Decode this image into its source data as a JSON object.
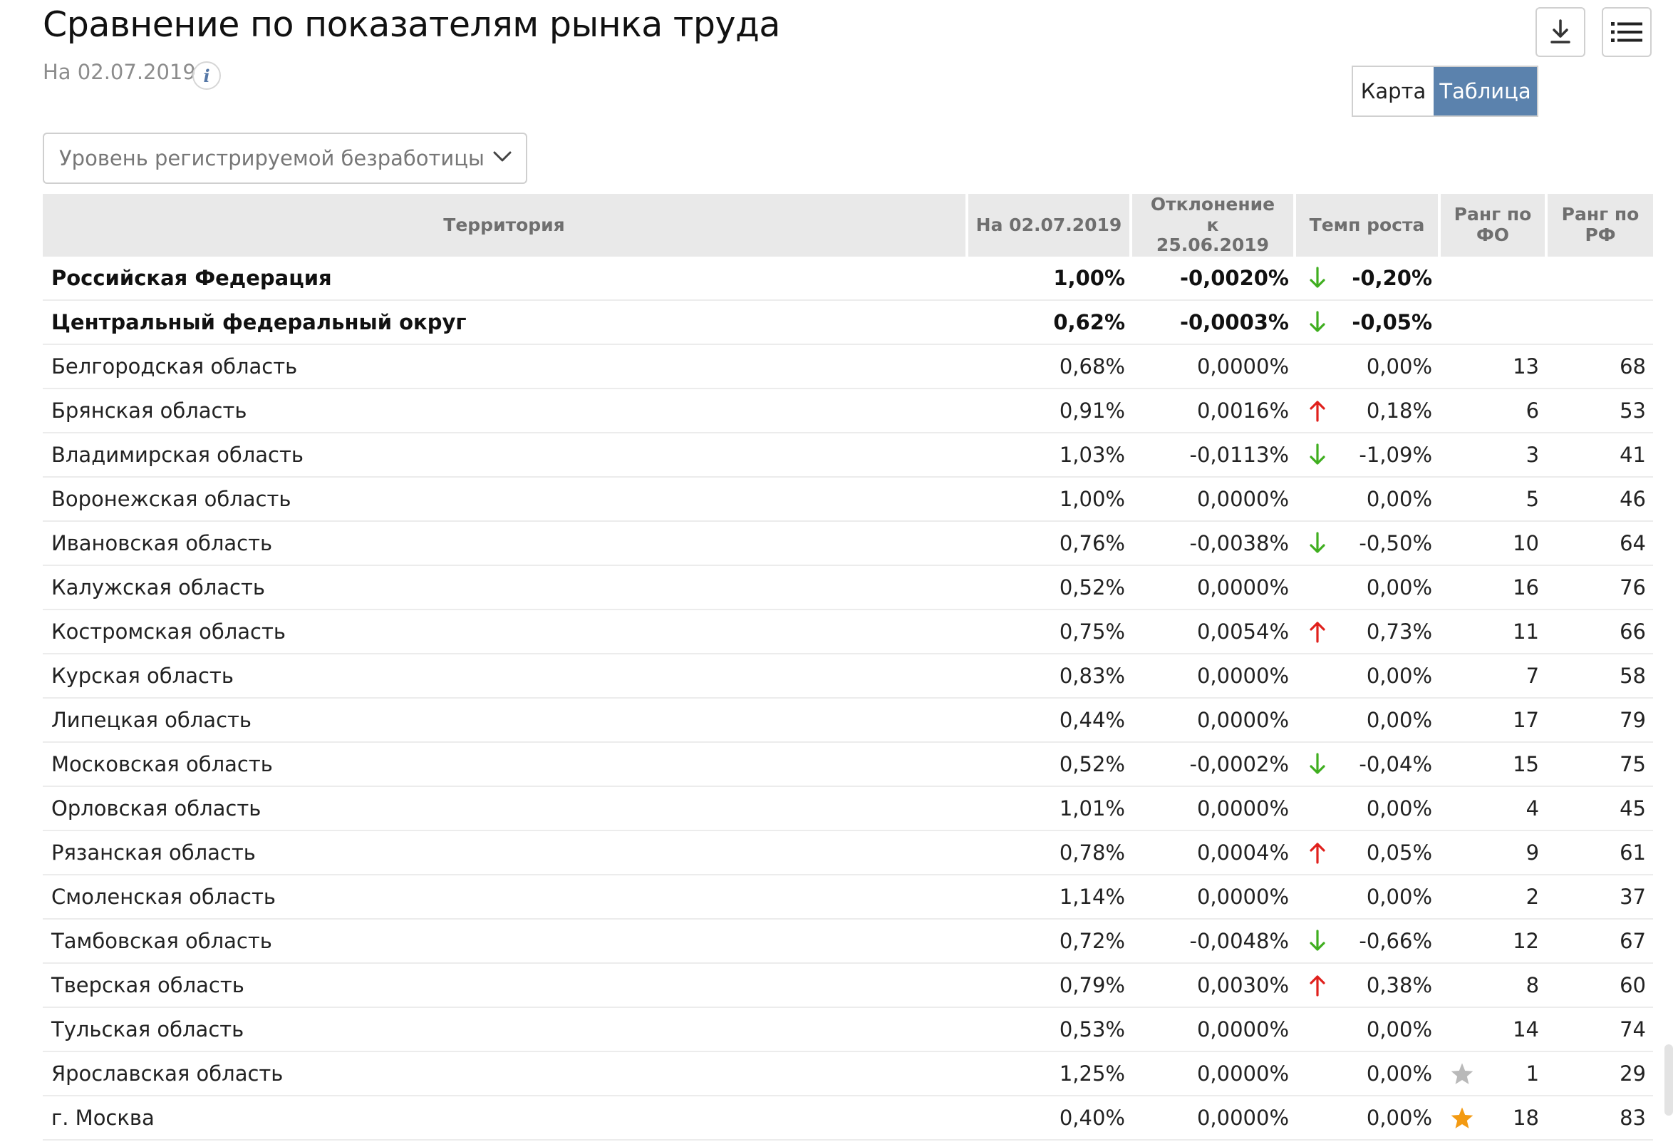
{
  "header": {
    "title": "Сравнение по показателям рынка труда",
    "date": "На 02.07.2019"
  },
  "view_toggle": {
    "map_label": "Карта",
    "table_label": "Таблица",
    "active": "Таблица"
  },
  "indicator": {
    "selected": "Уровень регистрируемой безработицы"
  },
  "icons": {
    "download": "download-icon",
    "menu": "list-menu-icon",
    "info": "info-icon",
    "up": "arrow-up-icon",
    "down": "arrow-down-icon",
    "star": "star-icon"
  },
  "colors": {
    "toggle_active": "#5b82ad",
    "arrow_up": "#e0201c",
    "arrow_down": "#3fae1f",
    "star_gold": "#f39a12",
    "star_gray": "#b9b9b9"
  },
  "table": {
    "columns": {
      "territory": "Территория",
      "value": "На 02.07.2019",
      "deviation": "Отклонение к 25.06.2019",
      "growth": "Темп роста",
      "rank_fo": "Ранг по ФО",
      "rank_rf": "Ранг по РФ"
    },
    "rows": [
      {
        "name": "Российская Федерация",
        "value": "1,00%",
        "deviation": "-0,0020%",
        "trend": "down",
        "growth": "-0,20%",
        "star": "",
        "rank_fo": "",
        "rank_rf": "",
        "bold": true
      },
      {
        "name": "Центральный федеральный округ",
        "value": "0,62%",
        "deviation": "-0,0003%",
        "trend": "down",
        "growth": "-0,05%",
        "star": "",
        "rank_fo": "",
        "rank_rf": "",
        "bold": true
      },
      {
        "name": "Белгородская область",
        "value": "0,68%",
        "deviation": "0,0000%",
        "trend": "",
        "growth": "0,00%",
        "star": "",
        "rank_fo": "13",
        "rank_rf": "68",
        "bold": false
      },
      {
        "name": "Брянская область",
        "value": "0,91%",
        "deviation": "0,0016%",
        "trend": "up",
        "growth": "0,18%",
        "star": "",
        "rank_fo": "6",
        "rank_rf": "53",
        "bold": false
      },
      {
        "name": "Владимирская область",
        "value": "1,03%",
        "deviation": "-0,0113%",
        "trend": "down",
        "growth": "-1,09%",
        "star": "",
        "rank_fo": "3",
        "rank_rf": "41",
        "bold": false
      },
      {
        "name": "Воронежская область",
        "value": "1,00%",
        "deviation": "0,0000%",
        "trend": "",
        "growth": "0,00%",
        "star": "",
        "rank_fo": "5",
        "rank_rf": "46",
        "bold": false
      },
      {
        "name": "Ивановская область",
        "value": "0,76%",
        "deviation": "-0,0038%",
        "trend": "down",
        "growth": "-0,50%",
        "star": "",
        "rank_fo": "10",
        "rank_rf": "64",
        "bold": false
      },
      {
        "name": "Калужская область",
        "value": "0,52%",
        "deviation": "0,0000%",
        "trend": "",
        "growth": "0,00%",
        "star": "",
        "rank_fo": "16",
        "rank_rf": "76",
        "bold": false
      },
      {
        "name": "Костромская область",
        "value": "0,75%",
        "deviation": "0,0054%",
        "trend": "up",
        "growth": "0,73%",
        "star": "",
        "rank_fo": "11",
        "rank_rf": "66",
        "bold": false
      },
      {
        "name": "Курская область",
        "value": "0,83%",
        "deviation": "0,0000%",
        "trend": "",
        "growth": "0,00%",
        "star": "",
        "rank_fo": "7",
        "rank_rf": "58",
        "bold": false
      },
      {
        "name": "Липецкая область",
        "value": "0,44%",
        "deviation": "0,0000%",
        "trend": "",
        "growth": "0,00%",
        "star": "",
        "rank_fo": "17",
        "rank_rf": "79",
        "bold": false
      },
      {
        "name": "Московская область",
        "value": "0,52%",
        "deviation": "-0,0002%",
        "trend": "down",
        "growth": "-0,04%",
        "star": "",
        "rank_fo": "15",
        "rank_rf": "75",
        "bold": false
      },
      {
        "name": "Орловская область",
        "value": "1,01%",
        "deviation": "0,0000%",
        "trend": "",
        "growth": "0,00%",
        "star": "",
        "rank_fo": "4",
        "rank_rf": "45",
        "bold": false
      },
      {
        "name": "Рязанская область",
        "value": "0,78%",
        "deviation": "0,0004%",
        "trend": "up",
        "growth": "0,05%",
        "star": "",
        "rank_fo": "9",
        "rank_rf": "61",
        "bold": false
      },
      {
        "name": "Смоленская область",
        "value": "1,14%",
        "deviation": "0,0000%",
        "trend": "",
        "growth": "0,00%",
        "star": "",
        "rank_fo": "2",
        "rank_rf": "37",
        "bold": false
      },
      {
        "name": "Тамбовская область",
        "value": "0,72%",
        "deviation": "-0,0048%",
        "trend": "down",
        "growth": "-0,66%",
        "star": "",
        "rank_fo": "12",
        "rank_rf": "67",
        "bold": false
      },
      {
        "name": "Тверская область",
        "value": "0,79%",
        "deviation": "0,0030%",
        "trend": "up",
        "growth": "0,38%",
        "star": "",
        "rank_fo": "8",
        "rank_rf": "60",
        "bold": false
      },
      {
        "name": "Тульская область",
        "value": "0,53%",
        "deviation": "0,0000%",
        "trend": "",
        "growth": "0,00%",
        "star": "",
        "rank_fo": "14",
        "rank_rf": "74",
        "bold": false
      },
      {
        "name": "Ярославская область",
        "value": "1,25%",
        "deviation": "0,0000%",
        "trend": "",
        "growth": "0,00%",
        "star": "gray",
        "rank_fo": "1",
        "rank_rf": "29",
        "bold": false
      },
      {
        "name": "г. Москва",
        "value": "0,40%",
        "deviation": "0,0000%",
        "trend": "",
        "growth": "0,00%",
        "star": "gold",
        "rank_fo": "18",
        "rank_rf": "83",
        "bold": false
      }
    ]
  }
}
